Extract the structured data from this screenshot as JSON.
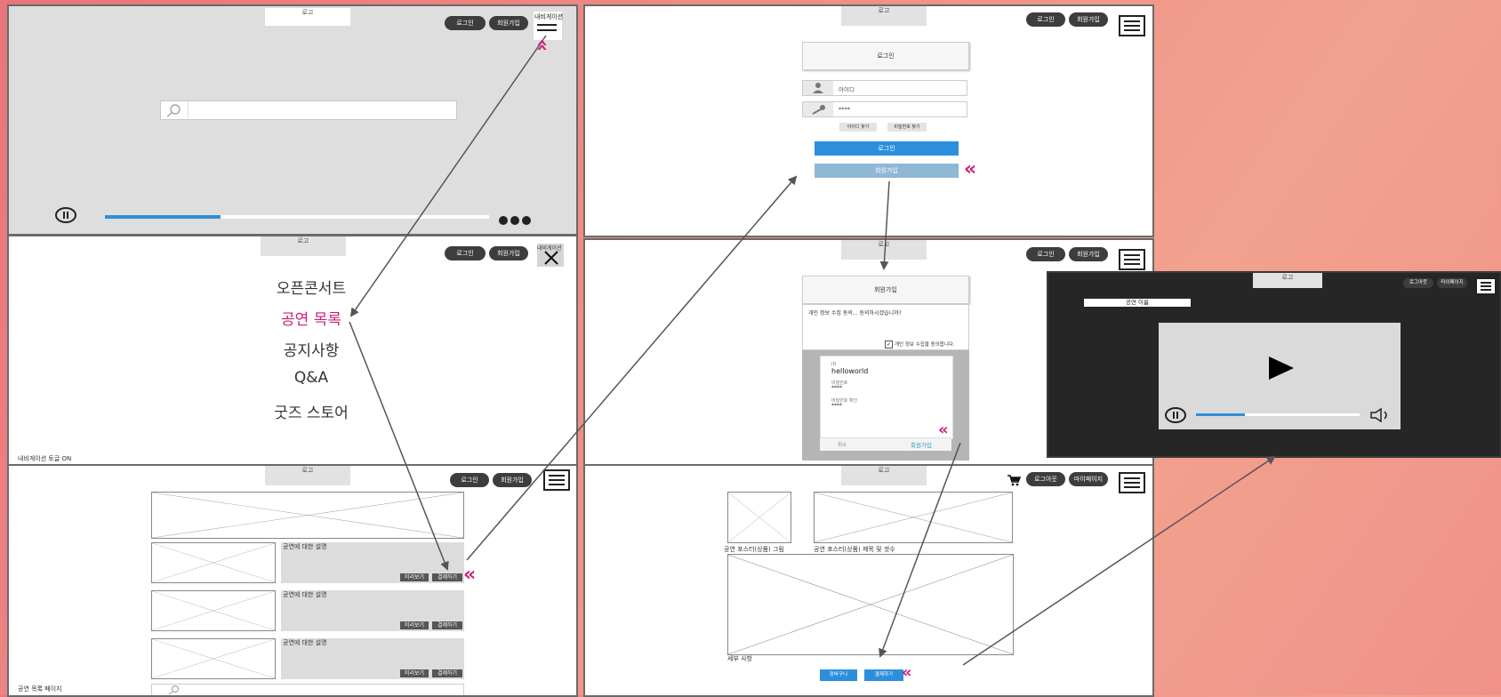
{
  "common": {
    "logo": "로고",
    "login": "로그인",
    "signup": "회원가입",
    "logout": "로그아웃",
    "mypage": "마이페이지",
    "nav_label": "내비게이션"
  },
  "colors": {
    "accent": "#2d8fdb",
    "highlight": "#cc1f7a",
    "dark": "#262626"
  },
  "screen1": {
    "progress": 0.3
  },
  "menu": {
    "items": [
      "오픈콘서트",
      "공연 목록",
      "공지사항",
      "Q&A",
      "굿즈 스토어"
    ],
    "active_index": 1,
    "footer": "내비게이션 토글 ON"
  },
  "list": {
    "desc": "공연에 대한 설명",
    "preview": "미리보기",
    "pay": "결제하기",
    "caption": "공연 목록 페이지"
  },
  "login": {
    "title": "로그인",
    "id_placeholder": "아이디",
    "pw_value": "****",
    "find_id": "아이디 찾기",
    "find_pw": "비밀번호 찾기",
    "login_btn": "로그인",
    "signup_btn": "회원가입"
  },
  "signup": {
    "title": "회원가입",
    "agree_text": "개인 정보 수집 동의... 동의하시겠습니까?",
    "agree_check": "개인 정보 수집을 동의합니다.",
    "id_label": "ID",
    "id_value": "helloworld",
    "pw_label": "비밀번호",
    "pw_value": "****",
    "pw_confirm_label": "비밀번호 확인",
    "pw_confirm_value": "****",
    "cancel": "취소",
    "submit": "회원가입"
  },
  "detail": {
    "poster_caption": "공연 포스터(상품) 그림",
    "title_caption": "공연 포스터(상품) 제목 및 갯수",
    "details_caption": "세부 사항",
    "cart_btn": "장바구니",
    "pay_btn": "결제하기"
  },
  "player": {
    "title": "공연 이름",
    "progress": 0.3
  }
}
